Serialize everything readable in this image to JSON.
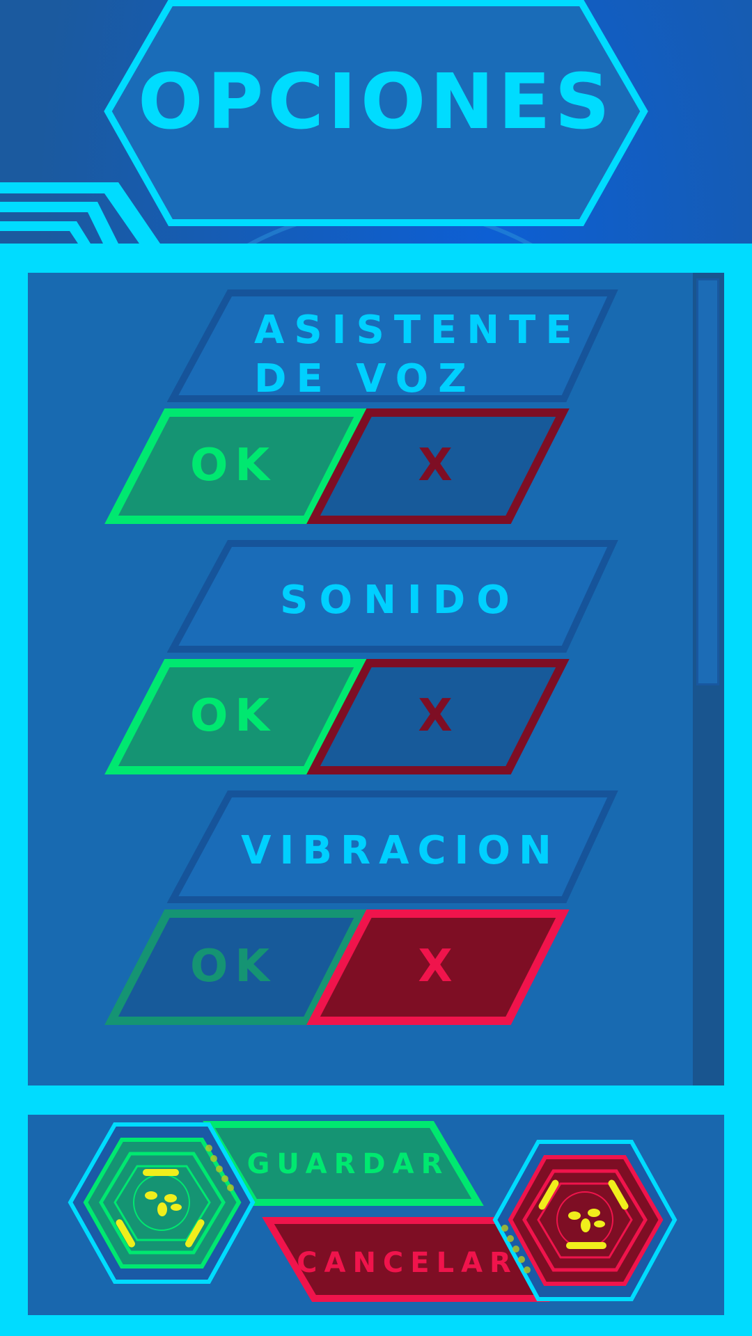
{
  "header": {
    "title": "OPCIONES"
  },
  "options": [
    {
      "label_line1": "ASISTENTE",
      "label_line2": "DE VOZ",
      "ok_label": "OK",
      "no_label": "X",
      "state": "ok"
    },
    {
      "label_line1": "SONIDO",
      "label_line2": "",
      "ok_label": "OK",
      "no_label": "X",
      "state": "ok"
    },
    {
      "label_line1": "VIBRACION",
      "label_line2": "",
      "ok_label": "OK",
      "no_label": "X",
      "state": "x"
    }
  ],
  "footer": {
    "save_label": "GUARDAR",
    "cancel_label": "CANCELAR",
    "save_icon": "leaf-emblem-icon",
    "cancel_icon": "leaf-emblem-icon"
  },
  "colors": {
    "background": "#1a5aa6",
    "frame": "#00dcff",
    "ok_active": "#00e870",
    "x_active": "#f0144c",
    "x_dark": "#7e0e24",
    "emblem_yellow": "#f0ee1c"
  }
}
